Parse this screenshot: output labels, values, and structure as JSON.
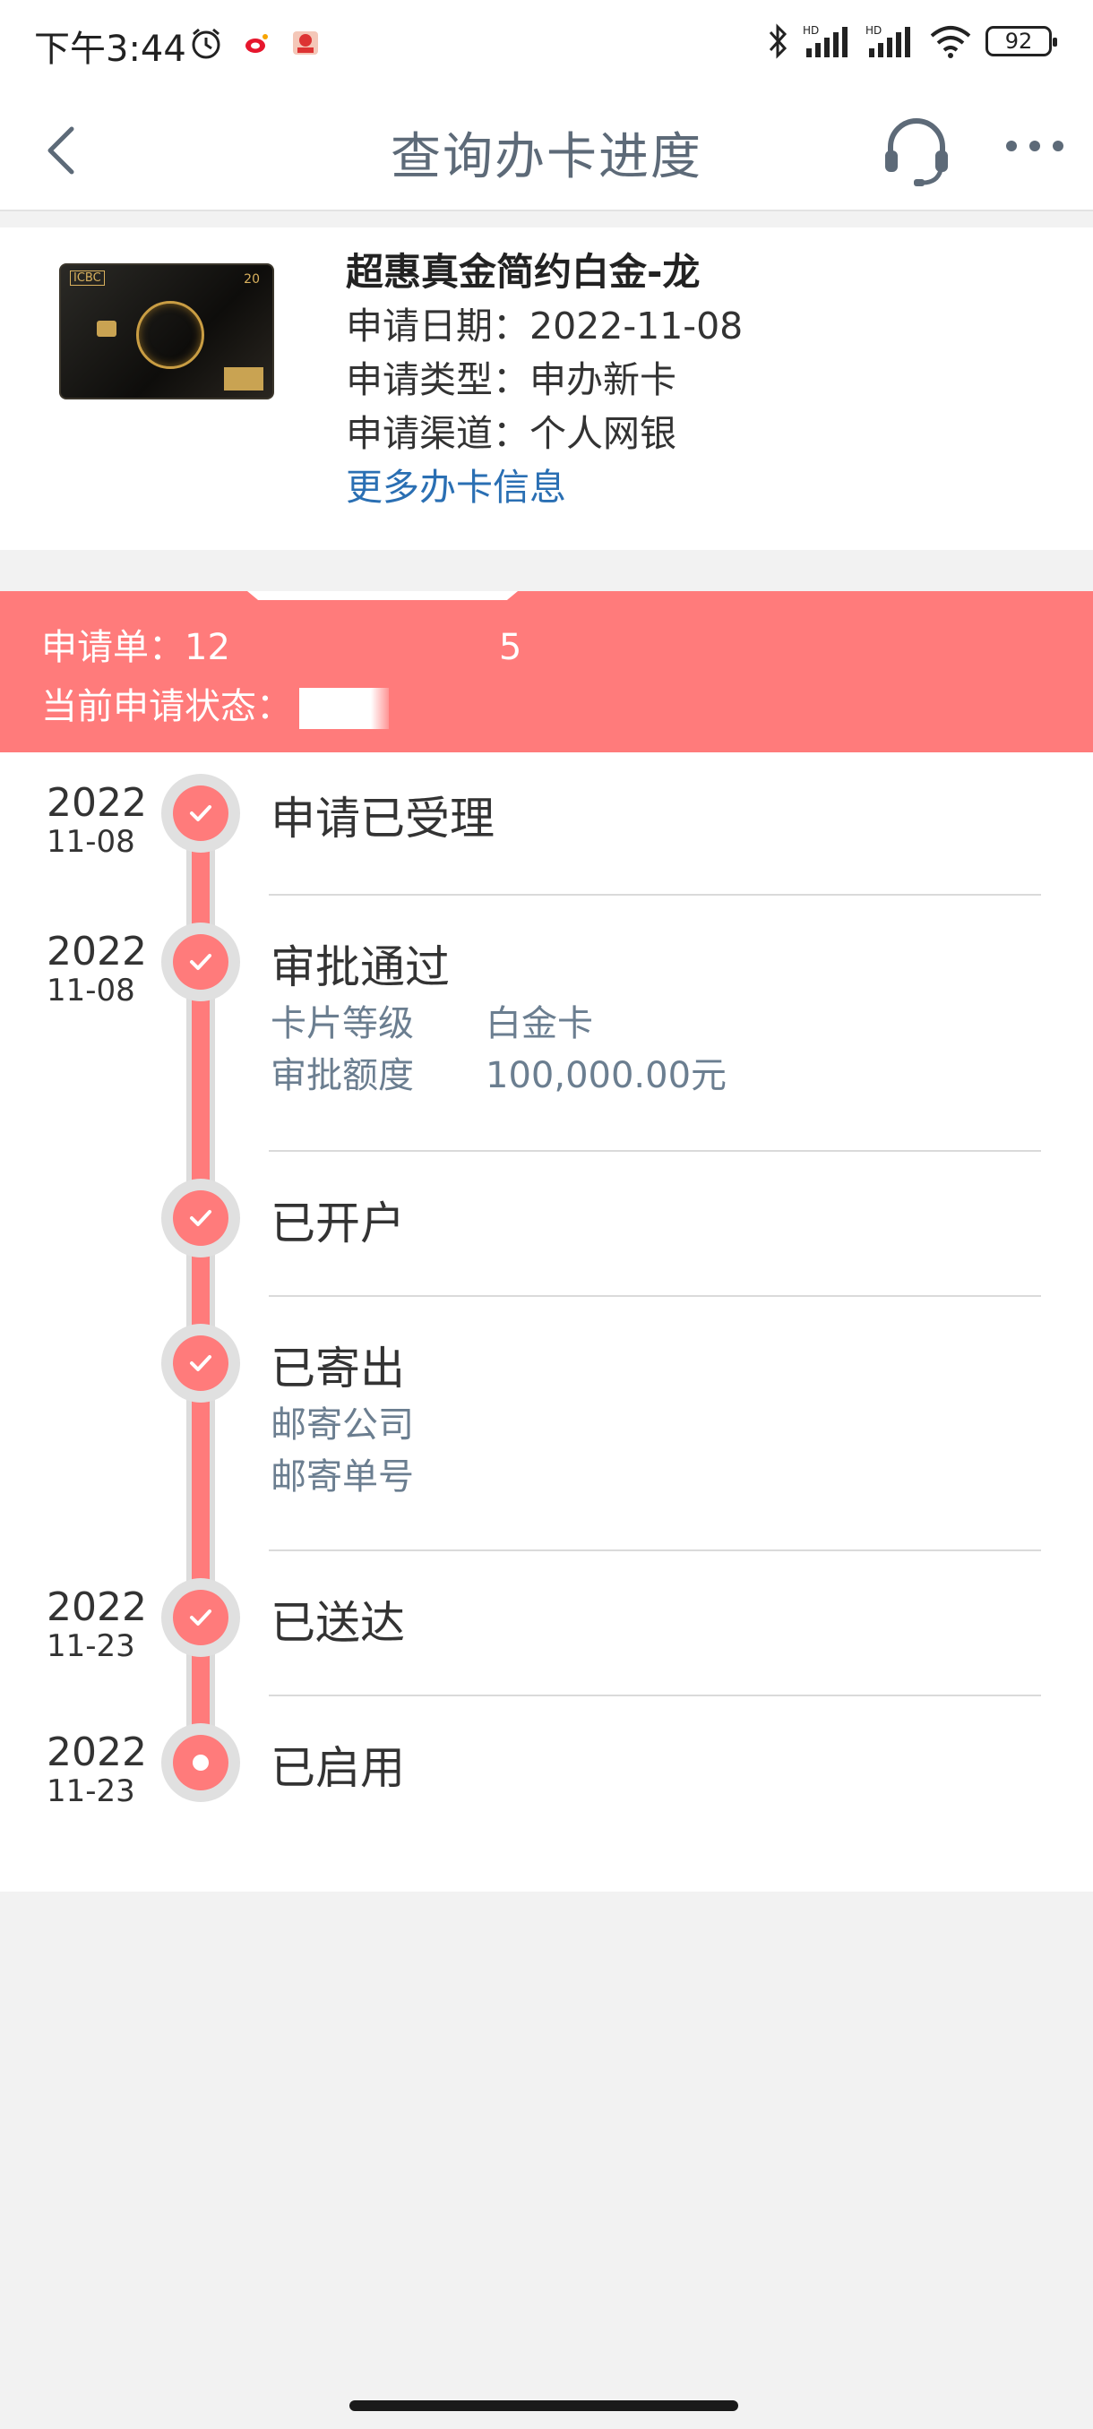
{
  "status_bar": {
    "time": "下午3:44",
    "battery": "92"
  },
  "nav": {
    "title": "查询办卡进度"
  },
  "card": {
    "name": "超惠真金简约白金-龙",
    "apply_date_label": "申请日期：",
    "apply_date": "2022-11-08",
    "apply_type_label": "申请类型：",
    "apply_type": "申办新卡",
    "channel_label": "申请渠道：",
    "channel": "个人网银",
    "more_info": "更多办卡信息",
    "image_brand": "ICBC",
    "image_number": "20"
  },
  "banner": {
    "app_label": "申请单：",
    "app_no_start": "12",
    "app_no_end": "5",
    "status_label": "当前申请状态："
  },
  "timeline": [
    {
      "year": "2022",
      "md": "11-08",
      "title": "申请已受理",
      "done": true
    },
    {
      "year": "2022",
      "md": "11-08",
      "title": "审批通过",
      "done": true,
      "details": [
        {
          "label": "卡片等级",
          "value": "白金卡"
        },
        {
          "label": "审批额度",
          "value": "100,000.00元"
        }
      ]
    },
    {
      "year": "",
      "md": "",
      "title": "已开户",
      "done": true
    },
    {
      "year": "",
      "md": "",
      "title": "已寄出",
      "done": true,
      "details": [
        {
          "label": "邮寄公司",
          "value": ""
        },
        {
          "label": "邮寄单号",
          "value": ""
        }
      ]
    },
    {
      "year": "2022",
      "md": "11-23",
      "title": "已送达",
      "done": true
    },
    {
      "year": "2022",
      "md": "11-23",
      "title": "已启用",
      "done": false
    }
  ],
  "colors": {
    "accent": "#ff7b7b",
    "link": "#2a6fb3",
    "title": "#5d6a78"
  }
}
